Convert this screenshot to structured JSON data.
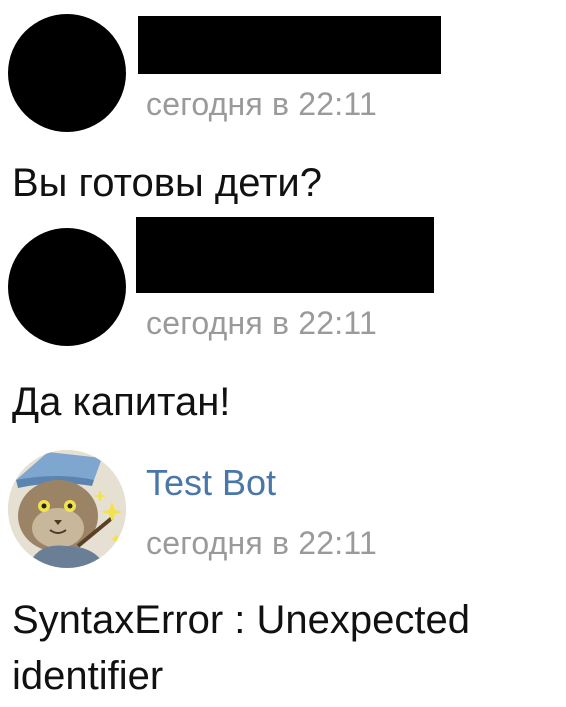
{
  "messages": [
    {
      "author": "",
      "author_redacted": true,
      "timestamp": "сегодня в 22:11",
      "text": "Вы готовы дети?"
    },
    {
      "author": "",
      "author_redacted": true,
      "timestamp": "сегодня в 22:11",
      "text": "Да капитан!"
    },
    {
      "author": "Test Bot",
      "author_redacted": false,
      "avatar_icon": "wizard-cat-icon",
      "timestamp": "сегодня в 22:11",
      "text_line1": "SyntaxError : Unexpected",
      "text_line2": "identifier"
    }
  ],
  "colors": {
    "author_link": "#4a76a8",
    "timestamp": "#9a9a9a",
    "message_text": "#111111",
    "redaction": "#000000"
  }
}
